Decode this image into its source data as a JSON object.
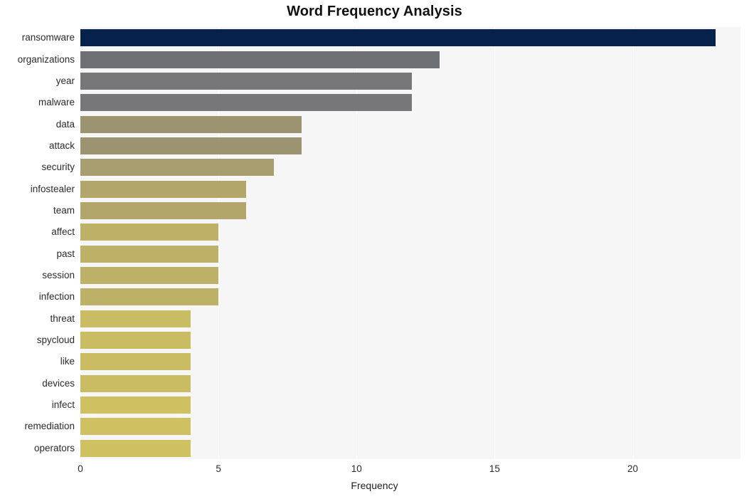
{
  "chart_data": {
    "type": "bar",
    "orientation": "horizontal",
    "title": "Word Frequency Analysis",
    "xlabel": "Frequency",
    "ylabel": "",
    "xlim": [
      0,
      23.9
    ],
    "ylim": [
      0,
      20
    ],
    "grid": true,
    "grid_axis": "x",
    "legend": false,
    "xticks": [
      0,
      5,
      10,
      15,
      20
    ],
    "xtick_labels": [
      "0",
      "5",
      "10",
      "15",
      "20"
    ],
    "categories": [
      "ransomware",
      "organizations",
      "year",
      "malware",
      "data",
      "attack",
      "security",
      "infostealer",
      "team",
      "affect",
      "past",
      "session",
      "infection",
      "threat",
      "spycloud",
      "like",
      "devices",
      "infect",
      "remediation",
      "operators"
    ],
    "values": [
      23,
      13,
      12,
      12,
      8,
      8,
      7,
      6,
      6,
      5,
      5,
      5,
      5,
      4,
      4,
      4,
      4,
      4,
      4,
      4
    ],
    "bar_colors": [
      "#04224c",
      "#6e7073",
      "#77777a",
      "#77777a",
      "#9c9471",
      "#9c9471",
      "#a89d6e",
      "#b2a66a",
      "#b2a66a",
      "#bdb067",
      "#bdb067",
      "#bdb067",
      "#bdb067",
      "#cabc63",
      "#cabc63",
      "#cabc63",
      "#cabc63",
      "#cfc062",
      "#cfc062",
      "#cfc062"
    ]
  },
  "style": {
    "plot_background": "#f6f6f7",
    "page_background": "#ffffff",
    "gridline_color": "#ffffff",
    "tick_label_color": "#2b2b2b",
    "title_color": "#111111"
  }
}
